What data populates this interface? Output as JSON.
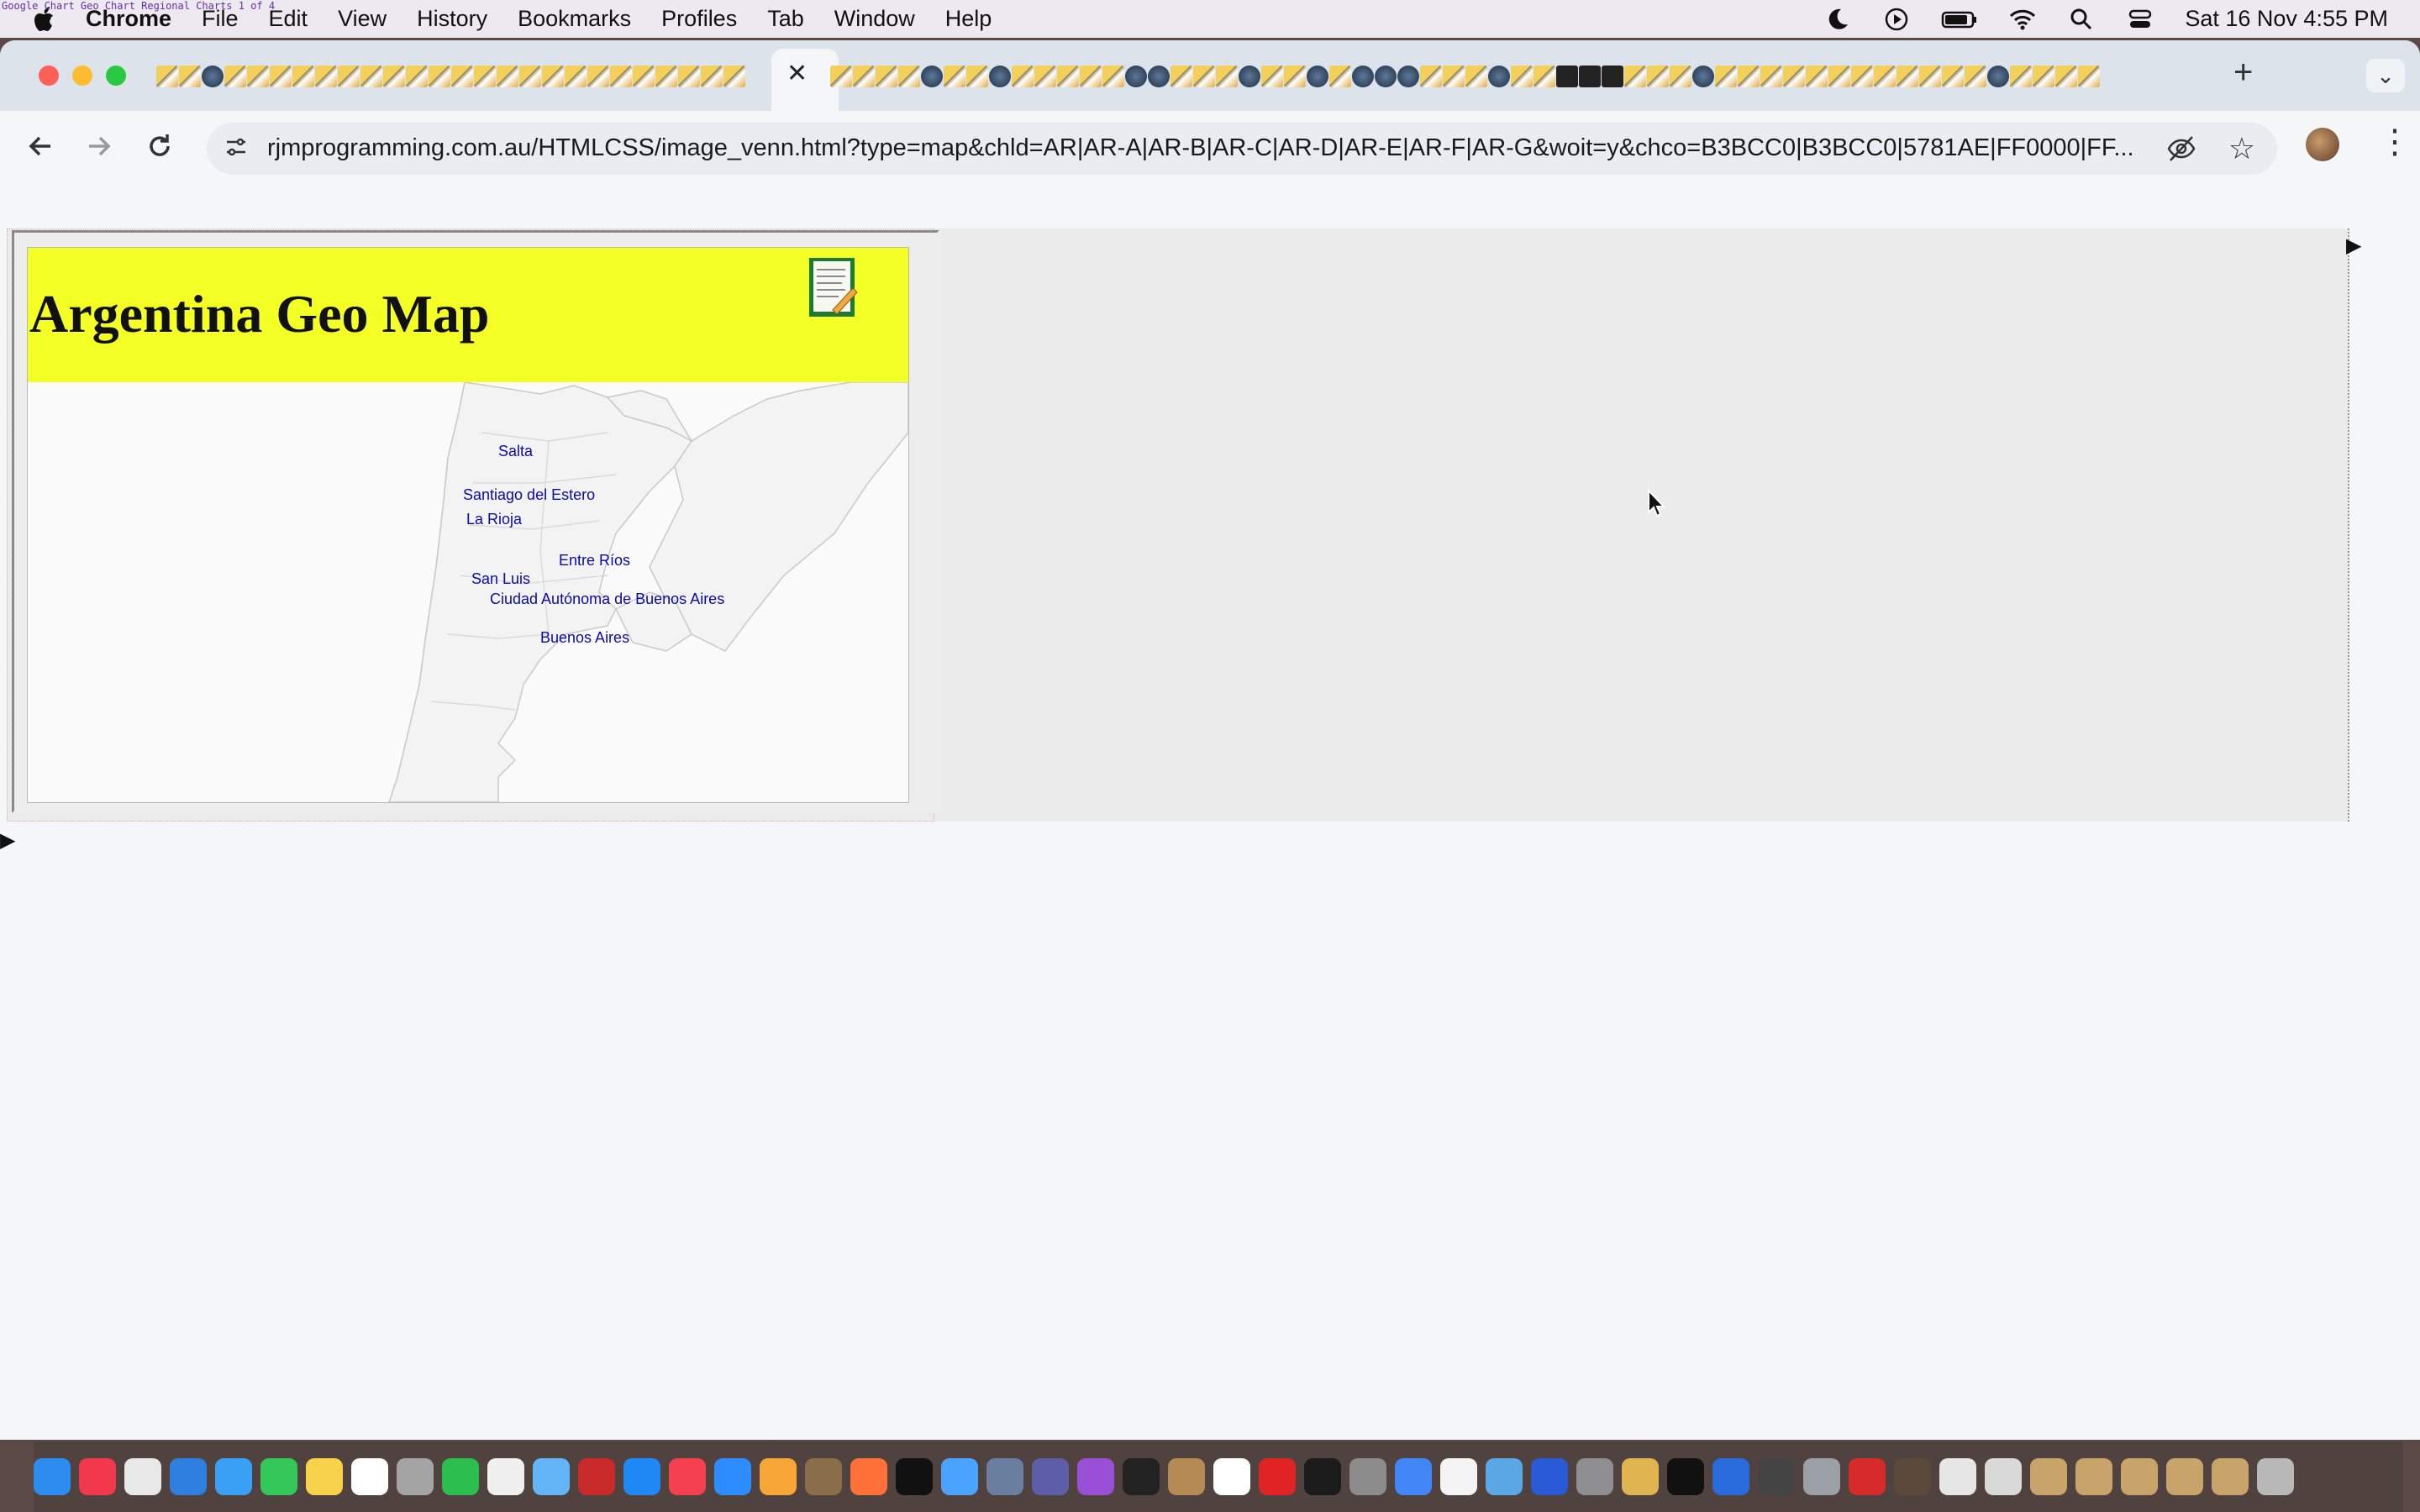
{
  "menubar": {
    "items": [
      "Chrome",
      "File",
      "Edit",
      "View",
      "History",
      "Bookmarks",
      "Profiles",
      "Tab",
      "Window",
      "Help"
    ],
    "clock": "Sat 16 Nov  4:55 PM",
    "status_icons": [
      "moon-icon",
      "play-icon",
      "battery-icon",
      "wifi-icon",
      "search-icon",
      "control-center-icon"
    ],
    "window_title_tiny": "Google Chart Geo Chart Regional Charts  1 of 4"
  },
  "browser": {
    "active_tab_close": "✕",
    "new_tab": "+",
    "tab_menu": "⌄",
    "url": "rjmprogramming.com.au/HTMLCSS/image_venn.html?type=map&chld=AR|AR-A|AR-B|AR-C|AR-D|AR-E|AR-F|AR-G&woit=y&chco=B3BCC0|B3BCC0|5781AE|FF0000|FF..."
  },
  "page": {
    "title": "Argentina Geo Map",
    "regions": [
      {
        "name": "Salta"
      },
      {
        "name": "Santiago del Estero"
      },
      {
        "name": "La Rioja"
      },
      {
        "name": "Entre Ríos"
      },
      {
        "name": "San Luis"
      },
      {
        "name": "Ciudad Autónoma de Buenos Aires"
      },
      {
        "name": "Buenos Aires"
      }
    ]
  },
  "colors": {
    "header_yellow": "#f4ff26",
    "label_blue": "#0a0aa8",
    "map_stroke": "#c9c9c9"
  }
}
